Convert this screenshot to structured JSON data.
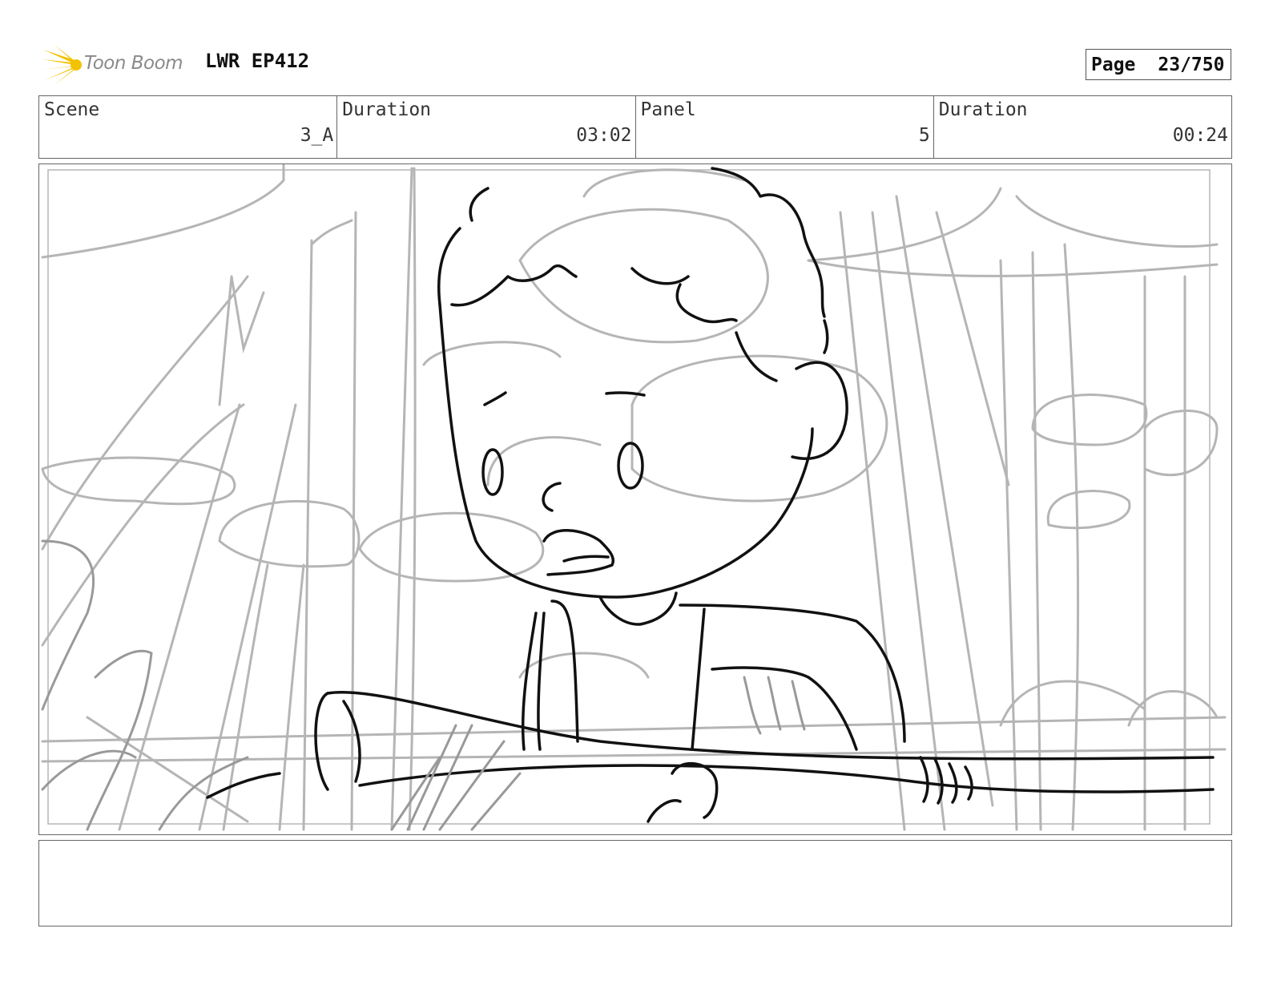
{
  "header": {
    "logo_text": "Toon Boom",
    "project_title": "LWR EP412",
    "page_label": "Page",
    "page_number": "23/750"
  },
  "info": {
    "scene_label": "Scene",
    "scene_value": "3_A",
    "scene_duration_label": "Duration",
    "scene_duration_value": "03:02",
    "panel_label": "Panel",
    "panel_value": "5",
    "panel_duration_label": "Duration",
    "panel_duration_value": "00:24"
  },
  "notes": {
    "text": ""
  },
  "colors": {
    "logo_accent": "#f2c200",
    "border": "#666666",
    "sketch_light": "#b5b5b5",
    "sketch_dark": "#111111"
  }
}
